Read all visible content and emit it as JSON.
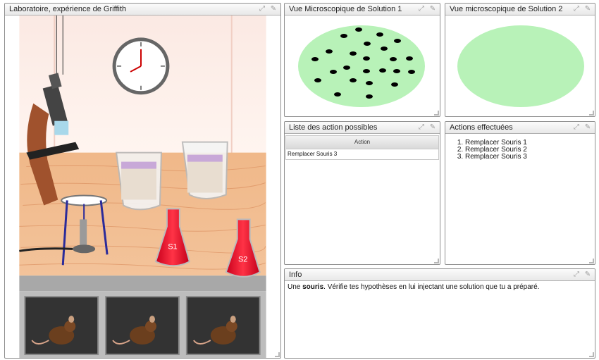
{
  "lab_panel": {
    "title": "Laboratoire, expérience de Griffith"
  },
  "micro1_panel": {
    "title": "Vue Microscopique de Solution 1"
  },
  "micro2_panel": {
    "title": "Vue microscopique de Solution 2"
  },
  "actions_possible_panel": {
    "title": "Liste des action possibles",
    "column_header": "Action",
    "rows": [
      "Remplacer Souris 3"
    ]
  },
  "actions_done_panel": {
    "title": "Actions effectuées",
    "items": [
      "Remplacer Souris 1",
      "Remplacer Souris 2",
      "Remplacer Souris 3"
    ]
  },
  "info_panel": {
    "title": "Info",
    "text_bold": "souris",
    "text_prefix": "Une ",
    "text_suffix": ". Vérifie tes hypothèses en lui injectant une solution que tu a préparé."
  },
  "flask_labels": {
    "s1": "S1",
    "s2": "S2"
  },
  "colors": {
    "petri_green": "#b8f2b8",
    "bacteria": "#000000",
    "solution_red": "#e8203a"
  },
  "icons": {
    "maximize": "expand-icon",
    "settings": "wrench-icon"
  }
}
